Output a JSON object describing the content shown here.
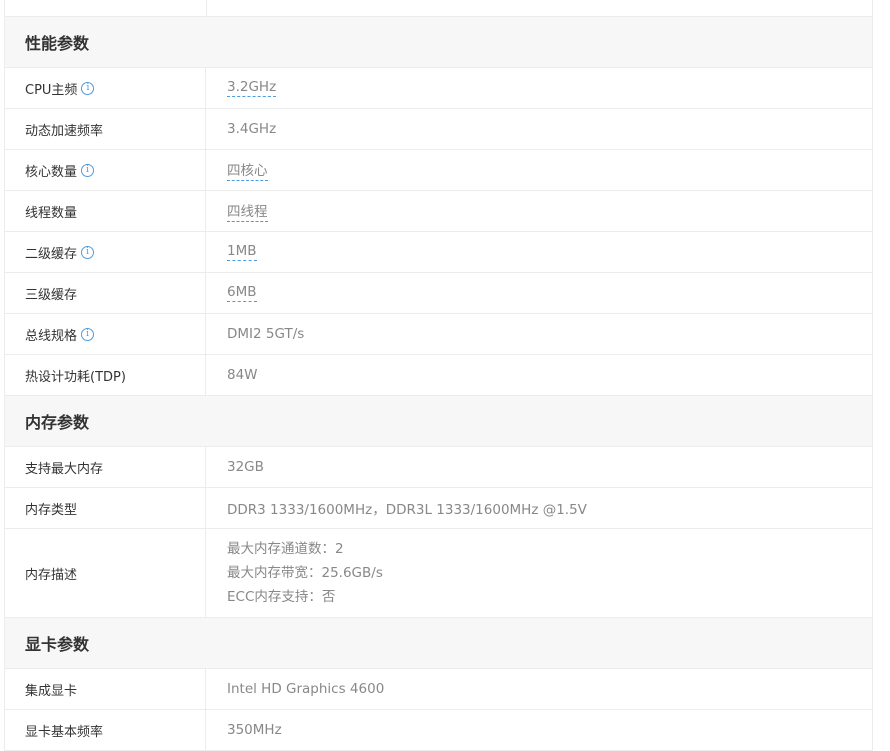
{
  "sections": [
    {
      "title": "性能参数",
      "rows": [
        {
          "label": "CPU主频",
          "info": true,
          "value": "3.2GHz",
          "link": true
        },
        {
          "label": "动态加速频率",
          "info": false,
          "value": "3.4GHz",
          "link": false
        },
        {
          "label": "核心数量",
          "info": true,
          "value": "四核心",
          "link": true
        },
        {
          "label": "线程数量",
          "info": false,
          "value": "四线程",
          "link": true
        },
        {
          "label": "二级缓存",
          "info": true,
          "value": "1MB",
          "link": true
        },
        {
          "label": "三级缓存",
          "info": false,
          "value": "6MB",
          "link": true
        },
        {
          "label": "总线规格",
          "info": true,
          "value": "DMI2 5GT/s",
          "link": false
        },
        {
          "label": "热设计功耗(TDP)",
          "info": false,
          "value": "84W",
          "link": false
        }
      ]
    },
    {
      "title": "内存参数",
      "rows": [
        {
          "label": "支持最大内存",
          "info": false,
          "value": "32GB",
          "link": false
        },
        {
          "label": "内存类型",
          "info": false,
          "value": "DDR3 1333/1600MHz，DDR3L 1333/1600MHz @1.5V",
          "link": false
        },
        {
          "label": "内存描述",
          "info": false,
          "lines": [
            "最大内存通道数：2",
            "最大内存带宽：25.6GB/s",
            "ECC内存支持：否"
          ]
        }
      ]
    },
    {
      "title": "显卡参数",
      "rows": [
        {
          "label": "集成显卡",
          "info": false,
          "value": "Intel HD Graphics 4600",
          "link": false
        },
        {
          "label": "显卡基本频率",
          "info": false,
          "value": "350MHz",
          "link": false
        }
      ]
    }
  ],
  "info_icon_glyph": "i",
  "colors": {
    "link_underline": "#4b9be0",
    "info_icon": "#4b9be0",
    "section_bg": "#f7f7f7",
    "border": "#ececec"
  }
}
